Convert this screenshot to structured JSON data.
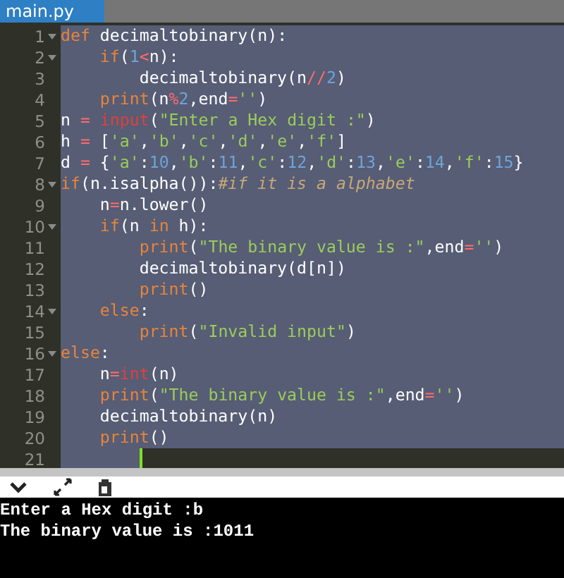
{
  "tab": {
    "label": "main.py",
    "selected": true
  },
  "lines": [
    {
      "number": "1",
      "fold": true,
      "selected": true,
      "cursor": false,
      "tokens": [
        {
          "text": "def",
          "kind": "keyword"
        },
        {
          "text": " decimaltobinary(n):",
          "kind": "plain"
        }
      ]
    },
    {
      "number": "2",
      "fold": true,
      "selected": true,
      "cursor": false,
      "tokens": [
        {
          "text": "    if",
          "kind": "keyword"
        },
        {
          "text": "(",
          "kind": "plain"
        },
        {
          "text": "1",
          "kind": "number"
        },
        {
          "text": "<",
          "kind": "op"
        },
        {
          "text": "n):",
          "kind": "plain"
        }
      ]
    },
    {
      "number": "3",
      "fold": false,
      "selected": true,
      "cursor": false,
      "tokens": [
        {
          "text": "        decimaltobinary(n",
          "kind": "plain"
        },
        {
          "text": "//",
          "kind": "op"
        },
        {
          "text": "2",
          "kind": "number"
        },
        {
          "text": ")",
          "kind": "plain"
        }
      ]
    },
    {
      "number": "4",
      "fold": false,
      "selected": true,
      "cursor": false,
      "tokens": [
        {
          "text": "    print",
          "kind": "keyword"
        },
        {
          "text": "(n",
          "kind": "plain"
        },
        {
          "text": "%",
          "kind": "op"
        },
        {
          "text": "2",
          "kind": "number"
        },
        {
          "text": ",end",
          "kind": "plain"
        },
        {
          "text": "=",
          "kind": "op"
        },
        {
          "text": "''",
          "kind": "string"
        },
        {
          "text": ")",
          "kind": "plain"
        }
      ]
    },
    {
      "number": "5",
      "fold": false,
      "selected": true,
      "cursor": false,
      "tokens": [
        {
          "text": "n ",
          "kind": "plain"
        },
        {
          "text": "=",
          "kind": "op"
        },
        {
          "text": " input",
          "kind": "builtin"
        },
        {
          "text": "(",
          "kind": "plain"
        },
        {
          "text": "\"Enter a Hex digit :\"",
          "kind": "string"
        },
        {
          "text": ")",
          "kind": "plain"
        }
      ]
    },
    {
      "number": "6",
      "fold": false,
      "selected": true,
      "cursor": false,
      "tokens": [
        {
          "text": "h ",
          "kind": "plain"
        },
        {
          "text": "=",
          "kind": "op"
        },
        {
          "text": " [",
          "kind": "plain"
        },
        {
          "text": "'a'",
          "kind": "string"
        },
        {
          "text": ",",
          "kind": "plain"
        },
        {
          "text": "'b'",
          "kind": "string"
        },
        {
          "text": ",",
          "kind": "plain"
        },
        {
          "text": "'c'",
          "kind": "string"
        },
        {
          "text": ",",
          "kind": "plain"
        },
        {
          "text": "'d'",
          "kind": "string"
        },
        {
          "text": ",",
          "kind": "plain"
        },
        {
          "text": "'e'",
          "kind": "string"
        },
        {
          "text": ",",
          "kind": "plain"
        },
        {
          "text": "'f'",
          "kind": "string"
        },
        {
          "text": "]",
          "kind": "plain"
        }
      ]
    },
    {
      "number": "7",
      "fold": false,
      "selected": true,
      "cursor": false,
      "tokens": [
        {
          "text": "d ",
          "kind": "plain"
        },
        {
          "text": "=",
          "kind": "op"
        },
        {
          "text": " {",
          "kind": "plain"
        },
        {
          "text": "'a'",
          "kind": "string"
        },
        {
          "text": ":",
          "kind": "plain"
        },
        {
          "text": "10",
          "kind": "number"
        },
        {
          "text": ",",
          "kind": "plain"
        },
        {
          "text": "'b'",
          "kind": "string"
        },
        {
          "text": ":",
          "kind": "plain"
        },
        {
          "text": "11",
          "kind": "number"
        },
        {
          "text": ",",
          "kind": "plain"
        },
        {
          "text": "'c'",
          "kind": "string"
        },
        {
          "text": ":",
          "kind": "plain"
        },
        {
          "text": "12",
          "kind": "number"
        },
        {
          "text": ",",
          "kind": "plain"
        },
        {
          "text": "'d'",
          "kind": "string"
        },
        {
          "text": ":",
          "kind": "plain"
        },
        {
          "text": "13",
          "kind": "number"
        },
        {
          "text": ",",
          "kind": "plain"
        },
        {
          "text": "'e'",
          "kind": "string"
        },
        {
          "text": ":",
          "kind": "plain"
        },
        {
          "text": "14",
          "kind": "number"
        },
        {
          "text": ",",
          "kind": "plain"
        },
        {
          "text": "'f'",
          "kind": "string"
        },
        {
          "text": ":",
          "kind": "plain"
        },
        {
          "text": "15",
          "kind": "number"
        },
        {
          "text": "}",
          "kind": "plain"
        }
      ]
    },
    {
      "number": "8",
      "fold": true,
      "selected": true,
      "cursor": false,
      "tokens": [
        {
          "text": "if",
          "kind": "keyword"
        },
        {
          "text": "(n.isalpha()):",
          "kind": "plain"
        },
        {
          "text": "#if it is a alphabet",
          "kind": "comment"
        }
      ]
    },
    {
      "number": "9",
      "fold": false,
      "selected": true,
      "cursor": false,
      "tokens": [
        {
          "text": "    n",
          "kind": "plain"
        },
        {
          "text": "=",
          "kind": "op"
        },
        {
          "text": "n.lower()",
          "kind": "plain"
        }
      ]
    },
    {
      "number": "10",
      "fold": true,
      "selected": true,
      "cursor": false,
      "tokens": [
        {
          "text": "    if",
          "kind": "keyword"
        },
        {
          "text": "(n ",
          "kind": "plain"
        },
        {
          "text": "in",
          "kind": "keyword"
        },
        {
          "text": " h):",
          "kind": "plain"
        }
      ]
    },
    {
      "number": "11",
      "fold": false,
      "selected": true,
      "cursor": false,
      "tokens": [
        {
          "text": "        print",
          "kind": "keyword"
        },
        {
          "text": "(",
          "kind": "plain"
        },
        {
          "text": "\"The binary value is :\"",
          "kind": "string"
        },
        {
          "text": ",end",
          "kind": "plain"
        },
        {
          "text": "=",
          "kind": "op"
        },
        {
          "text": "''",
          "kind": "string"
        },
        {
          "text": ")",
          "kind": "plain"
        }
      ]
    },
    {
      "number": "12",
      "fold": false,
      "selected": true,
      "cursor": false,
      "tokens": [
        {
          "text": "        decimaltobinary(d[n])",
          "kind": "plain"
        }
      ]
    },
    {
      "number": "13",
      "fold": false,
      "selected": true,
      "cursor": false,
      "tokens": [
        {
          "text": "        print",
          "kind": "keyword"
        },
        {
          "text": "()",
          "kind": "plain"
        }
      ]
    },
    {
      "number": "14",
      "fold": true,
      "selected": true,
      "cursor": false,
      "tokens": [
        {
          "text": "    else",
          "kind": "keyword"
        },
        {
          "text": ":",
          "kind": "plain"
        }
      ]
    },
    {
      "number": "15",
      "fold": false,
      "selected": true,
      "cursor": false,
      "tokens": [
        {
          "text": "        print",
          "kind": "keyword"
        },
        {
          "text": "(",
          "kind": "plain"
        },
        {
          "text": "\"Invalid input\"",
          "kind": "string"
        },
        {
          "text": ")",
          "kind": "plain"
        }
      ]
    },
    {
      "number": "16",
      "fold": true,
      "selected": true,
      "cursor": false,
      "tokens": [
        {
          "text": "else",
          "kind": "keyword"
        },
        {
          "text": ":",
          "kind": "plain"
        }
      ]
    },
    {
      "number": "17",
      "fold": false,
      "selected": true,
      "cursor": false,
      "tokens": [
        {
          "text": "    n",
          "kind": "plain"
        },
        {
          "text": "=",
          "kind": "op"
        },
        {
          "text": "int",
          "kind": "builtin"
        },
        {
          "text": "(n)",
          "kind": "plain"
        }
      ]
    },
    {
      "number": "18",
      "fold": false,
      "selected": true,
      "cursor": false,
      "tokens": [
        {
          "text": "    print",
          "kind": "keyword"
        },
        {
          "text": "(",
          "kind": "plain"
        },
        {
          "text": "\"The binary value is :\"",
          "kind": "string"
        },
        {
          "text": ",end",
          "kind": "plain"
        },
        {
          "text": "=",
          "kind": "op"
        },
        {
          "text": "''",
          "kind": "string"
        },
        {
          "text": ")",
          "kind": "plain"
        }
      ]
    },
    {
      "number": "19",
      "fold": false,
      "selected": true,
      "cursor": false,
      "tokens": [
        {
          "text": "    decimaltobinary(n)",
          "kind": "plain"
        }
      ]
    },
    {
      "number": "20",
      "fold": false,
      "selected": true,
      "cursor": false,
      "tokens": [
        {
          "text": "    print",
          "kind": "keyword"
        },
        {
          "text": "()",
          "kind": "plain"
        }
      ]
    },
    {
      "number": "21",
      "fold": false,
      "selected": false,
      "cursor": true
    }
  ],
  "console": [
    "Enter a Hex digit :b",
    "The binary value is :1011"
  ]
}
